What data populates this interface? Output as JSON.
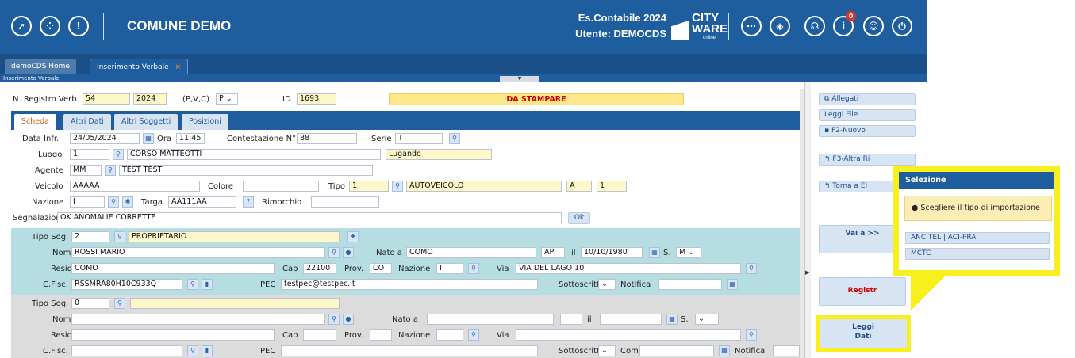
{
  "topbar": {
    "left_icons": [
      "rocket-icon",
      "grid-icon",
      "info-icon"
    ],
    "app_title": "COMUNE DEMO",
    "es_contabile": "Es.Contabile 2024",
    "utente": "Utente: DEMOCDS",
    "brand_line1": "CITY",
    "brand_line2": "WARE",
    "brand_sub": "online",
    "right_icons": [
      "chat-icon",
      "compass-icon",
      "support-icon",
      "notification-icon",
      "user-icon",
      "power-icon"
    ],
    "notification_count": "0"
  },
  "tabs": {
    "home": "demoCDS Home",
    "active": "Inserimento Verbale",
    "close": "×"
  },
  "subbar_title": "Inserimento Verbale",
  "header_form": {
    "n_registro_label": "N. Registro Verb.",
    "n_registro": "54",
    "anno": "2024",
    "pvc_label": "(P,V,C)",
    "pvc_value": "P",
    "id_label": "ID",
    "id_value": "1693",
    "status": "DA STAMPARE"
  },
  "form_tabs": [
    "Scheda",
    "Altri Dati",
    "Altri Soggetti",
    "Posizioni"
  ],
  "scheda": {
    "data_infr_label": "Data Infr.",
    "data_infr": "24/05/2024",
    "ora_label": "Ora",
    "ora": "11:45",
    "contestazione_label": "Contestazione N°",
    "contestazione": "88",
    "serie_label": "Serie",
    "serie": "T",
    "luogo_label": "Luogo",
    "luogo_code": "1",
    "luogo_name": "CORSO MATTEOTTI",
    "luogo_city": "Lugando",
    "agente_label": "Agente",
    "agente_code": "MM",
    "agente_name": "TEST TEST",
    "veicolo_label": "Veicolo",
    "veicolo": "AAAAA",
    "colore_label": "Colore",
    "colore": "",
    "tipo_label": "Tipo",
    "tipo_code": "1",
    "tipo_name": "AUTOVEICOLO",
    "tipo_a": "A",
    "tipo_n": "1",
    "nazione_label": "Nazione",
    "nazione": "I",
    "targa_label": "Targa",
    "targa": "AA111AA",
    "rimorchio_label": "Rimorchio",
    "rimorchio": "",
    "segnalazioni_label": "Segnalazioni",
    "segnalazioni": "OK ANOMALIE CORRETTE",
    "ok_label": "Ok"
  },
  "soggetto1": {
    "tipo_sog_label": "Tipo Sog.",
    "tipo_sog": "2",
    "tipo_sog_name": "PROPRIETARIO",
    "nome_label": "Nome",
    "nome": "ROSSI MARIO",
    "nato_a_label": "Nato a",
    "nato_a": "COMO",
    "prov_nascita": "AP",
    "il_label": "il",
    "data_nascita": "10/10/1980",
    "sesso_label": "S.",
    "sesso": "M",
    "resid_label": "Resid.",
    "resid": "COMO",
    "cap_label": "Cap",
    "cap": "22100",
    "prov_label": "Prov.",
    "prov": "CO",
    "nazione_label": "Nazione",
    "nazione": "I",
    "via_label": "Via",
    "via": "VIA DEL LAGO 10",
    "cfisc_label": "C.Fisc.",
    "cfisc": "RSSMRA80H10C933Q",
    "pec_label": "PEC",
    "pec": "testpec@testpec.it",
    "sottoscritt_label": "Sottoscritt.",
    "notifica_label": "Notifica"
  },
  "soggetto2": {
    "tipo_sog_label": "Tipo Sog.",
    "tipo_sog": "0",
    "nome_label": "Nome",
    "nato_a_label": "Nato a",
    "il_label": "il",
    "sesso_label": "S.",
    "resid_label": "Resid.",
    "cap_label": "Cap",
    "prov_label": "Prov.",
    "nazione_label": "Nazione",
    "via_label": "Via",
    "cfisc_label": "C.Fisc.",
    "pec_label": "PEC",
    "sottoscritt_label": "Sottoscritt.",
    "com_label": "Com.",
    "notifica_label": "Notifica"
  },
  "sidebar": {
    "allegati": "Allegati",
    "leggi_file": "Leggi File",
    "f2_nuovo": "F2-Nuovo",
    "f3_altra": "F3-Altra Ri",
    "torna_a": "Torna a El",
    "vai_a": "Vai a >>",
    "registra": "Registr",
    "leggi_dati_1": "Leggi",
    "leggi_dati_2": "Dati"
  },
  "popup": {
    "title": "Selezione",
    "message": "Scegliere il tipo di importazione",
    "options": [
      "ANCITEL | ACI-PRA",
      "MCTC"
    ]
  },
  "colors": {
    "primary": "#1e5d9e",
    "highlight": "#f7f01d",
    "status_text": "#d10000",
    "soggetto_bg": "#b5dde2"
  }
}
